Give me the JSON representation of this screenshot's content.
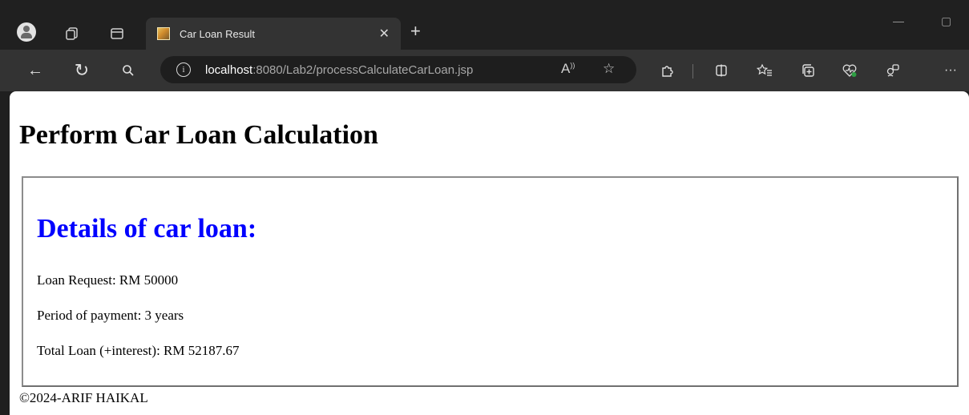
{
  "browser": {
    "tab": {
      "title": "Car Loan Result"
    },
    "address_bar": {
      "url_host": "localhost",
      "url_rest": ":8080/Lab2/processCalculateCarLoan.jsp"
    },
    "icons": {
      "profile": "profile-avatar-icon",
      "workspaces": "workspaces-icon",
      "tab_actions": "tab-actions-icon",
      "new_tab": "+",
      "tab_close": "✕",
      "back": "←",
      "refresh": "↻",
      "search": "search-icon",
      "info": "i",
      "read_aloud": "A",
      "favorite": "☆",
      "more": "···"
    }
  },
  "page": {
    "heading": "Perform Car Loan Calculation",
    "result": {
      "title": "Details of car loan:",
      "loan_request": "Loan Request: RM 50000",
      "period": "Period of payment: 3 years",
      "total": "Total Loan (+interest): RM 52187.67"
    },
    "footer": "©2024-ARIF HAIKAL"
  },
  "colors": {
    "result_title": "#0000ff",
    "tab_strip": "#202020",
    "toolbar": "#333333",
    "address_bar": "#1e1e1e"
  }
}
